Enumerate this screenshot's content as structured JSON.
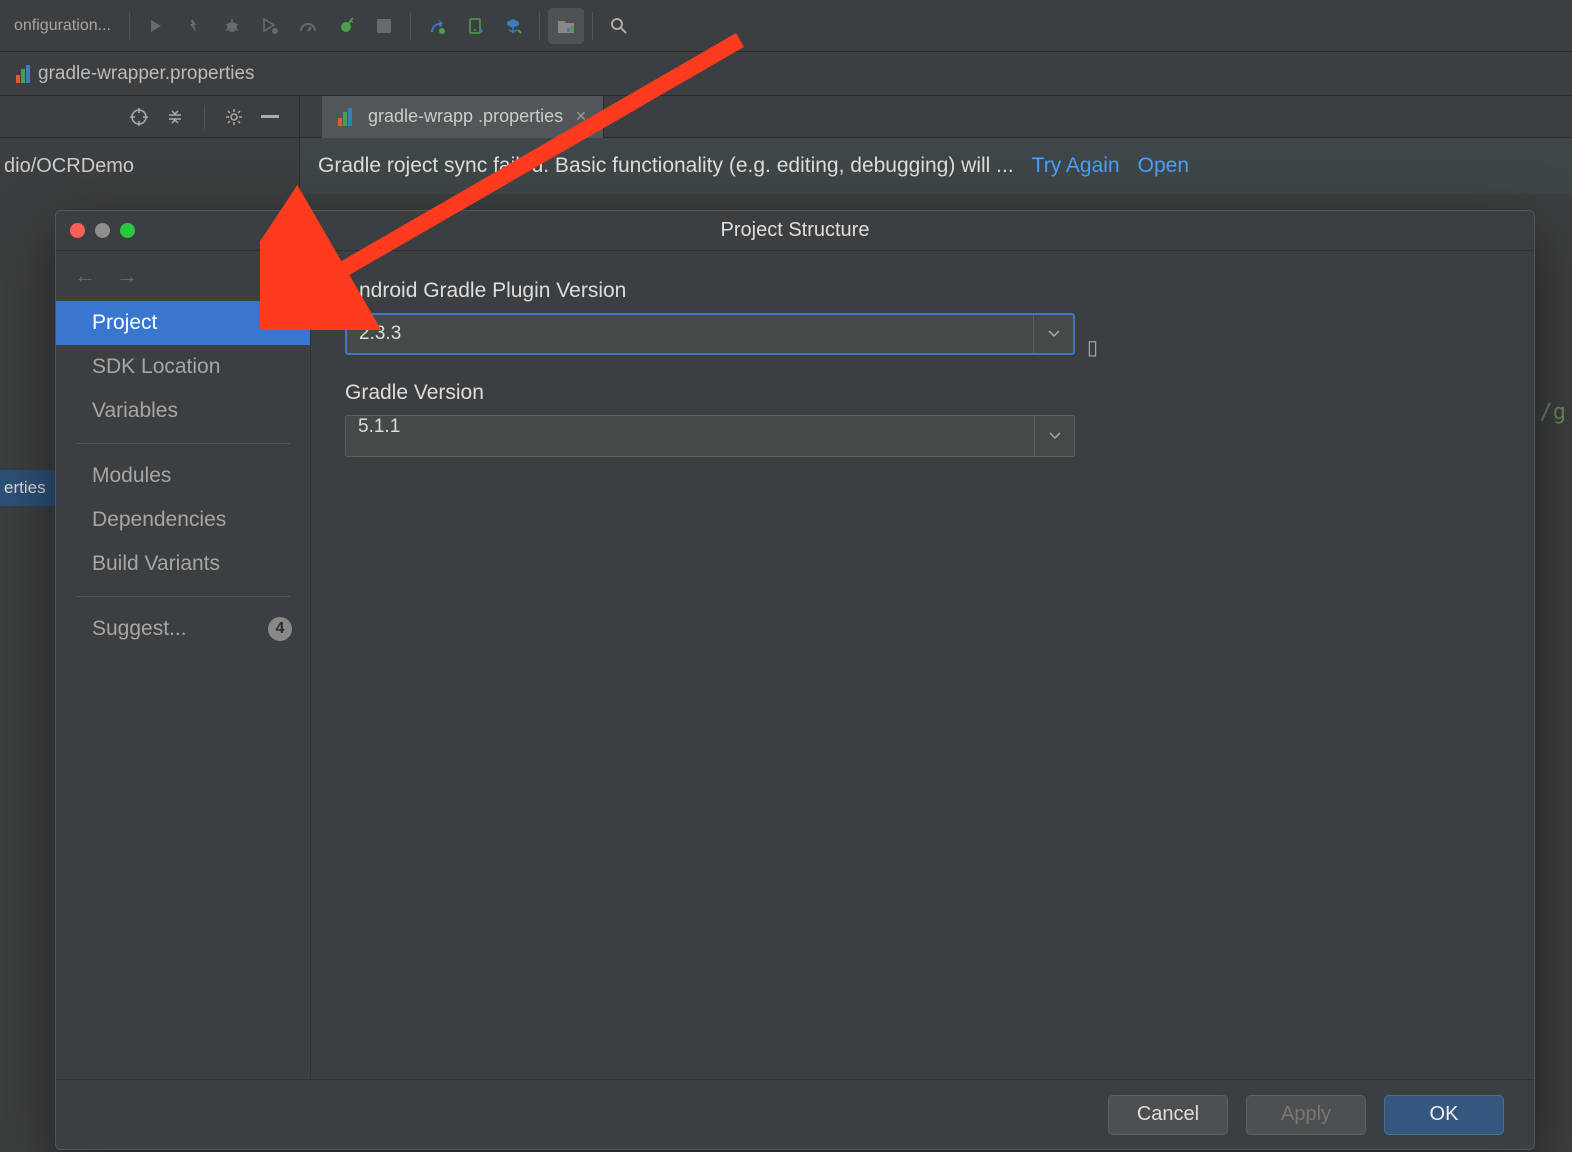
{
  "toolbar": {
    "config_label": "onfiguration..."
  },
  "tabs": {
    "file_tab": "gradle-wrapper.properties"
  },
  "editor_tab": {
    "label": "gradle-wrapp    .properties"
  },
  "breadcrumb": "dio/OCRDemo",
  "warning": {
    "text": "Gradle   roject sync failed. Basic functionality (e.g. editing, debugging) will ...",
    "try_again": "Try Again",
    "open": "Open"
  },
  "gutter_selected": "erties",
  "code_hint": "/g",
  "dialog": {
    "title": "Project Structure",
    "sidebar": {
      "project": "Project",
      "sdk": "SDK Location",
      "variables": "Variables",
      "modules": "Modules",
      "dependencies": "Dependencies",
      "build_variants": "Build Variants",
      "suggest": "Suggest...",
      "suggest_badge": "4"
    },
    "fields": {
      "agp_label": "Android Gradle Plugin Version",
      "agp_value": "2.3.3",
      "gradle_label": "Gradle Version",
      "gradle_value": "5.1.1"
    },
    "buttons": {
      "cancel": "Cancel",
      "apply": "Apply",
      "ok": "OK"
    }
  }
}
